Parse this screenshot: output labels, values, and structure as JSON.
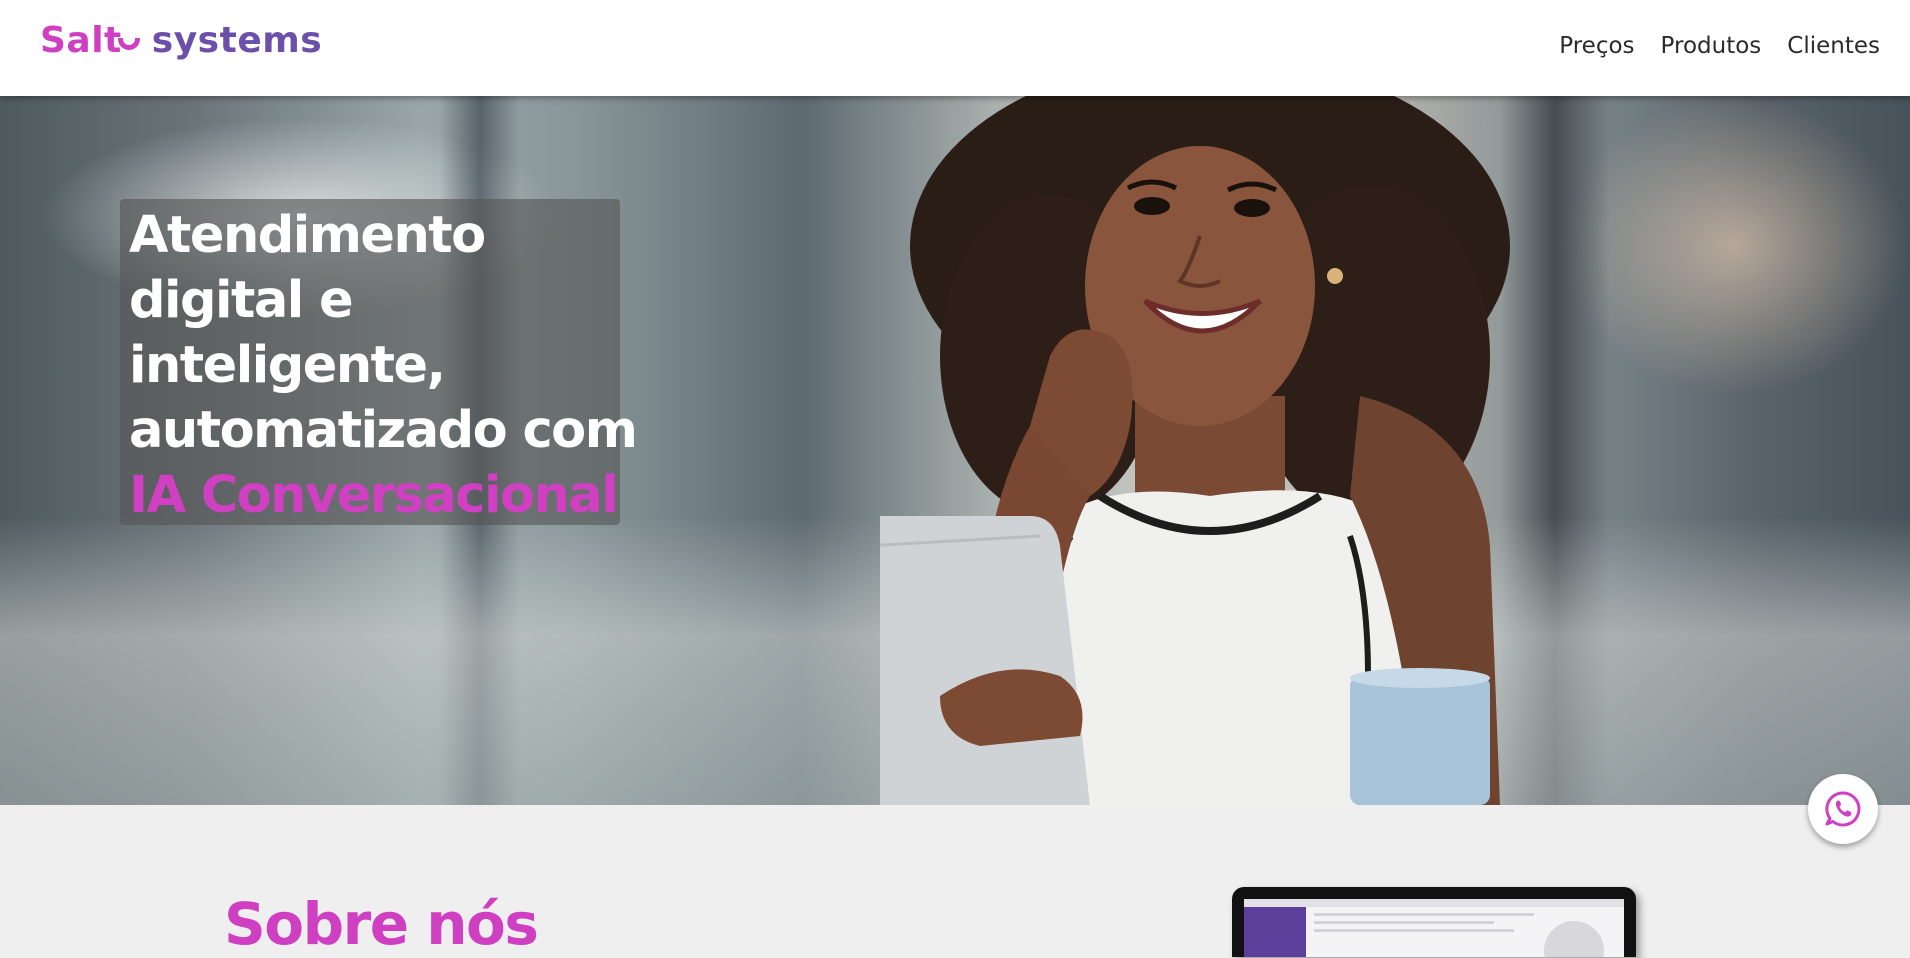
{
  "header": {
    "logo": {
      "part1": "Salt",
      "part2": "systems",
      "colors": {
        "salt": "#cf3fc1",
        "systems": "#6b4fa8"
      }
    },
    "nav": [
      {
        "label": "Preços"
      },
      {
        "label": "Produtos"
      },
      {
        "label": "Clientes"
      }
    ]
  },
  "hero": {
    "title_lines": [
      "Atendimento",
      "digital e",
      "inteligente,",
      "automatizado com"
    ],
    "title_accent": "IA Conversacional",
    "accent_color": "#d13fc3",
    "image": "smiling-woman-with-tablet-photo"
  },
  "floating": {
    "whatsapp_icon": "whatsapp-icon",
    "color": "#cf3fc1"
  },
  "about": {
    "title": "Sobre nós",
    "image": "laptop-screenshot"
  }
}
